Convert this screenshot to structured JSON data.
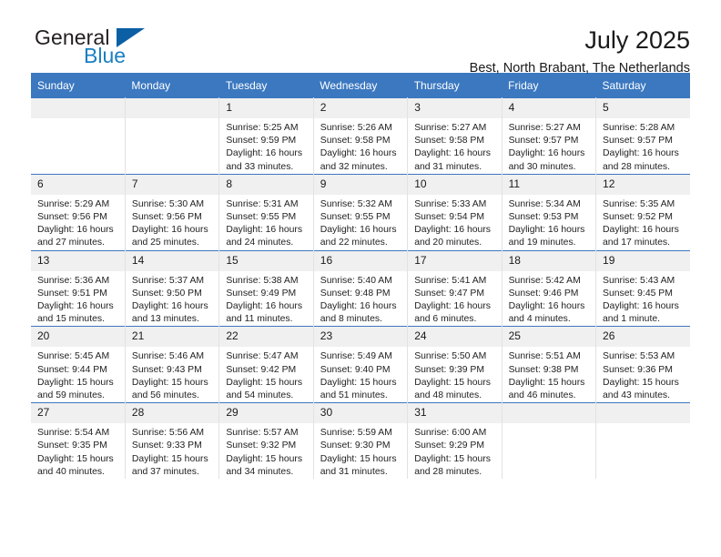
{
  "brand": {
    "name_part1": "General",
    "name_part2": "Blue",
    "triangle_icon": "blue-triangle-icon"
  },
  "header": {
    "title": "July 2025",
    "subtitle": "Best, North Brabant, The Netherlands"
  },
  "colors": {
    "header_blue": "#3b78c0",
    "daynum_gray": "#f0f0f0",
    "logo_blue": "#1a7fc1",
    "triangle_blue": "#0b5fa5"
  },
  "weekday_headers": [
    "Sunday",
    "Monday",
    "Tuesday",
    "Wednesday",
    "Thursday",
    "Friday",
    "Saturday"
  ],
  "labels": {
    "sunrise": "Sunrise:",
    "sunset": "Sunset:",
    "daylight": "Daylight:"
  },
  "weeks": [
    [
      {
        "day": "",
        "sunrise": "",
        "sunset": "",
        "daylight1": "",
        "daylight2": ""
      },
      {
        "day": "",
        "sunrise": "",
        "sunset": "",
        "daylight1": "",
        "daylight2": ""
      },
      {
        "day": "1",
        "sunrise": "Sunrise: 5:25 AM",
        "sunset": "Sunset: 9:59 PM",
        "daylight1": "Daylight: 16 hours",
        "daylight2": "and 33 minutes."
      },
      {
        "day": "2",
        "sunrise": "Sunrise: 5:26 AM",
        "sunset": "Sunset: 9:58 PM",
        "daylight1": "Daylight: 16 hours",
        "daylight2": "and 32 minutes."
      },
      {
        "day": "3",
        "sunrise": "Sunrise: 5:27 AM",
        "sunset": "Sunset: 9:58 PM",
        "daylight1": "Daylight: 16 hours",
        "daylight2": "and 31 minutes."
      },
      {
        "day": "4",
        "sunrise": "Sunrise: 5:27 AM",
        "sunset": "Sunset: 9:57 PM",
        "daylight1": "Daylight: 16 hours",
        "daylight2": "and 30 minutes."
      },
      {
        "day": "5",
        "sunrise": "Sunrise: 5:28 AM",
        "sunset": "Sunset: 9:57 PM",
        "daylight1": "Daylight: 16 hours",
        "daylight2": "and 28 minutes."
      }
    ],
    [
      {
        "day": "6",
        "sunrise": "Sunrise: 5:29 AM",
        "sunset": "Sunset: 9:56 PM",
        "daylight1": "Daylight: 16 hours",
        "daylight2": "and 27 minutes."
      },
      {
        "day": "7",
        "sunrise": "Sunrise: 5:30 AM",
        "sunset": "Sunset: 9:56 PM",
        "daylight1": "Daylight: 16 hours",
        "daylight2": "and 25 minutes."
      },
      {
        "day": "8",
        "sunrise": "Sunrise: 5:31 AM",
        "sunset": "Sunset: 9:55 PM",
        "daylight1": "Daylight: 16 hours",
        "daylight2": "and 24 minutes."
      },
      {
        "day": "9",
        "sunrise": "Sunrise: 5:32 AM",
        "sunset": "Sunset: 9:55 PM",
        "daylight1": "Daylight: 16 hours",
        "daylight2": "and 22 minutes."
      },
      {
        "day": "10",
        "sunrise": "Sunrise: 5:33 AM",
        "sunset": "Sunset: 9:54 PM",
        "daylight1": "Daylight: 16 hours",
        "daylight2": "and 20 minutes."
      },
      {
        "day": "11",
        "sunrise": "Sunrise: 5:34 AM",
        "sunset": "Sunset: 9:53 PM",
        "daylight1": "Daylight: 16 hours",
        "daylight2": "and 19 minutes."
      },
      {
        "day": "12",
        "sunrise": "Sunrise: 5:35 AM",
        "sunset": "Sunset: 9:52 PM",
        "daylight1": "Daylight: 16 hours",
        "daylight2": "and 17 minutes."
      }
    ],
    [
      {
        "day": "13",
        "sunrise": "Sunrise: 5:36 AM",
        "sunset": "Sunset: 9:51 PM",
        "daylight1": "Daylight: 16 hours",
        "daylight2": "and 15 minutes."
      },
      {
        "day": "14",
        "sunrise": "Sunrise: 5:37 AM",
        "sunset": "Sunset: 9:50 PM",
        "daylight1": "Daylight: 16 hours",
        "daylight2": "and 13 minutes."
      },
      {
        "day": "15",
        "sunrise": "Sunrise: 5:38 AM",
        "sunset": "Sunset: 9:49 PM",
        "daylight1": "Daylight: 16 hours",
        "daylight2": "and 11 minutes."
      },
      {
        "day": "16",
        "sunrise": "Sunrise: 5:40 AM",
        "sunset": "Sunset: 9:48 PM",
        "daylight1": "Daylight: 16 hours",
        "daylight2": "and 8 minutes."
      },
      {
        "day": "17",
        "sunrise": "Sunrise: 5:41 AM",
        "sunset": "Sunset: 9:47 PM",
        "daylight1": "Daylight: 16 hours",
        "daylight2": "and 6 minutes."
      },
      {
        "day": "18",
        "sunrise": "Sunrise: 5:42 AM",
        "sunset": "Sunset: 9:46 PM",
        "daylight1": "Daylight: 16 hours",
        "daylight2": "and 4 minutes."
      },
      {
        "day": "19",
        "sunrise": "Sunrise: 5:43 AM",
        "sunset": "Sunset: 9:45 PM",
        "daylight1": "Daylight: 16 hours",
        "daylight2": "and 1 minute."
      }
    ],
    [
      {
        "day": "20",
        "sunrise": "Sunrise: 5:45 AM",
        "sunset": "Sunset: 9:44 PM",
        "daylight1": "Daylight: 15 hours",
        "daylight2": "and 59 minutes."
      },
      {
        "day": "21",
        "sunrise": "Sunrise: 5:46 AM",
        "sunset": "Sunset: 9:43 PM",
        "daylight1": "Daylight: 15 hours",
        "daylight2": "and 56 minutes."
      },
      {
        "day": "22",
        "sunrise": "Sunrise: 5:47 AM",
        "sunset": "Sunset: 9:42 PM",
        "daylight1": "Daylight: 15 hours",
        "daylight2": "and 54 minutes."
      },
      {
        "day": "23",
        "sunrise": "Sunrise: 5:49 AM",
        "sunset": "Sunset: 9:40 PM",
        "daylight1": "Daylight: 15 hours",
        "daylight2": "and 51 minutes."
      },
      {
        "day": "24",
        "sunrise": "Sunrise: 5:50 AM",
        "sunset": "Sunset: 9:39 PM",
        "daylight1": "Daylight: 15 hours",
        "daylight2": "and 48 minutes."
      },
      {
        "day": "25",
        "sunrise": "Sunrise: 5:51 AM",
        "sunset": "Sunset: 9:38 PM",
        "daylight1": "Daylight: 15 hours",
        "daylight2": "and 46 minutes."
      },
      {
        "day": "26",
        "sunrise": "Sunrise: 5:53 AM",
        "sunset": "Sunset: 9:36 PM",
        "daylight1": "Daylight: 15 hours",
        "daylight2": "and 43 minutes."
      }
    ],
    [
      {
        "day": "27",
        "sunrise": "Sunrise: 5:54 AM",
        "sunset": "Sunset: 9:35 PM",
        "daylight1": "Daylight: 15 hours",
        "daylight2": "and 40 minutes."
      },
      {
        "day": "28",
        "sunrise": "Sunrise: 5:56 AM",
        "sunset": "Sunset: 9:33 PM",
        "daylight1": "Daylight: 15 hours",
        "daylight2": "and 37 minutes."
      },
      {
        "day": "29",
        "sunrise": "Sunrise: 5:57 AM",
        "sunset": "Sunset: 9:32 PM",
        "daylight1": "Daylight: 15 hours",
        "daylight2": "and 34 minutes."
      },
      {
        "day": "30",
        "sunrise": "Sunrise: 5:59 AM",
        "sunset": "Sunset: 9:30 PM",
        "daylight1": "Daylight: 15 hours",
        "daylight2": "and 31 minutes."
      },
      {
        "day": "31",
        "sunrise": "Sunrise: 6:00 AM",
        "sunset": "Sunset: 9:29 PM",
        "daylight1": "Daylight: 15 hours",
        "daylight2": "and 28 minutes."
      },
      {
        "day": "",
        "sunrise": "",
        "sunset": "",
        "daylight1": "",
        "daylight2": ""
      },
      {
        "day": "",
        "sunrise": "",
        "sunset": "",
        "daylight1": "",
        "daylight2": ""
      }
    ]
  ]
}
